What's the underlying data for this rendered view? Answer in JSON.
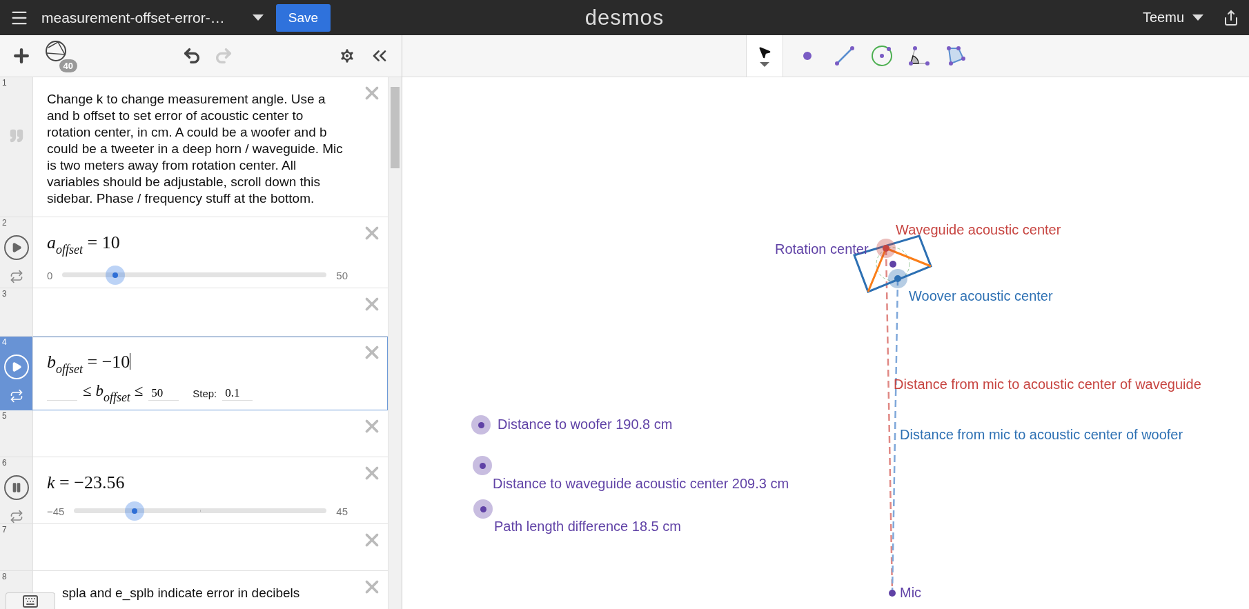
{
  "topbar": {
    "title": "measurement-offset-error-…",
    "save": "Save",
    "logo": "desmos",
    "user": "Teemu"
  },
  "sidebar_toolbar": {
    "object_count": "40",
    "redo_disabled": true
  },
  "expressions": [
    {
      "number": "1",
      "kind": "note",
      "selected": false,
      "text": "Change k to change measurement angle. Use a and b offset to set error of acoustic center to rotation center, in cm. A could be a woofer and b could be a tweeter in a deep horn / waveguide. Mic is two meters away from rotation center. All variables should be adjustable, scroll down this sidebar. Phase / frequency stuff at the bottom."
    },
    {
      "number": "2",
      "kind": "slider",
      "selected": false,
      "playing": false,
      "base": "a",
      "sub": "offset",
      "rel": "=",
      "value": "10",
      "min": "0",
      "max": "50",
      "level": 0.2
    },
    {
      "number": "3",
      "kind": "empty",
      "selected": false
    },
    {
      "number": "4",
      "kind": "range",
      "selected": true,
      "playing": false,
      "base": "b",
      "sub": "offset",
      "rel": "=",
      "value": "−10",
      "le": "≤",
      "range_base": "b",
      "range_sub": "offset",
      "le2": "≤",
      "max": "50",
      "step_label": "Step:",
      "step": "0.1"
    },
    {
      "number": "5",
      "kind": "empty",
      "selected": false
    },
    {
      "number": "6",
      "kind": "slider",
      "selected": false,
      "playing": true,
      "base": "k",
      "rel": "=",
      "value": "−23.56",
      "min": "−45",
      "max": "45",
      "level": 0.238
    },
    {
      "number": "7",
      "kind": "empty",
      "selected": false
    },
    {
      "number": "8",
      "kind": "note",
      "selected": false,
      "text": "spla and e_splb indicate error in decibels"
    }
  ],
  "canvas_tools": [
    {
      "kind": "pointer",
      "selected": true
    },
    {
      "kind": "point",
      "selected": false
    },
    {
      "kind": "segment",
      "selected": false
    },
    {
      "kind": "circle",
      "selected": false
    },
    {
      "kind": "angle",
      "selected": false
    },
    {
      "kind": "polygon",
      "selected": false
    }
  ],
  "canvas_labels": [
    {
      "text": "Waveguide acoustic center",
      "color": "#c74440"
    },
    {
      "text": "Rotation center",
      "color": "#6042a6"
    },
    {
      "text": "Woover acoustic center",
      "color": "#2d70b3"
    },
    {
      "text": "Distance from mic to acoustic center of waveguide",
      "color": "#c74440"
    },
    {
      "text": "Distance from mic to acoustic center of woofer",
      "color": "#2d70b3"
    },
    {
      "text": "Mic",
      "color": "#6042a6"
    },
    {
      "text": "Distance to woofer 190.8 cm",
      "color": "#6042a6"
    },
    {
      "text": "Distance to waveguide acoustic center 209.3 cm",
      "color": "#6042a6"
    },
    {
      "text": "Path length difference 18.5 cm",
      "color": "#6042a6"
    }
  ]
}
